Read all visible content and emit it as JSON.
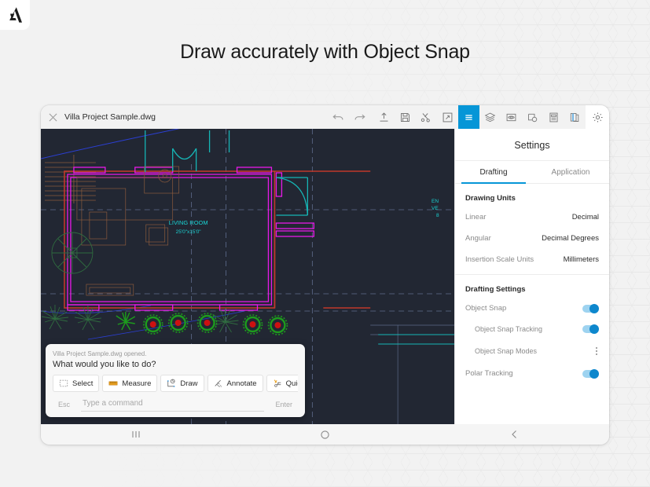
{
  "brand": {
    "logo_icon": "autodesk-logo"
  },
  "headline": "Draw accurately with Object Snap",
  "window": {
    "document_title": "Villa Project Sample.dwg",
    "close_icon": "close-icon",
    "toolbar": [
      {
        "name": "undo",
        "icon": "undo-icon",
        "state": "normal"
      },
      {
        "name": "redo",
        "icon": "redo-icon",
        "state": "normal"
      },
      {
        "name": "export",
        "icon": "export-upload-icon",
        "state": "normal"
      },
      {
        "name": "save",
        "icon": "save-floppy-icon",
        "state": "normal"
      },
      {
        "name": "trim",
        "icon": "trim-scissors-icon",
        "state": "normal"
      },
      {
        "name": "zoom-extents",
        "icon": "zoom-extents-icon",
        "state": "normal"
      },
      {
        "name": "menu",
        "icon": "hamburger-menu-icon",
        "state": "active-blue"
      },
      {
        "name": "layers",
        "icon": "layers-icon",
        "state": "normal"
      },
      {
        "name": "visibility",
        "icon": "eye-visibility-icon",
        "state": "normal"
      },
      {
        "name": "snap",
        "icon": "object-snap-icon",
        "state": "normal"
      },
      {
        "name": "properties",
        "icon": "properties-panel-icon",
        "state": "normal"
      },
      {
        "name": "copy",
        "icon": "copy-document-icon",
        "state": "normal"
      },
      {
        "name": "settings",
        "icon": "gear-settings-icon",
        "state": "active-white"
      }
    ]
  },
  "canvas": {
    "room_label": "LIVING ROOM",
    "room_dimensions": "25'0\"x15'0\"",
    "side_label_line1": "EN",
    "side_label_line2": "VE",
    "side_label_line3": "8",
    "colors": {
      "background": "#222733",
      "wall": "#c0392b",
      "window": "#e819e8",
      "door": "#16b5b5",
      "text": "#19d4d4",
      "guide": "#6b7a9e",
      "furniture": "#8a5a3c",
      "vegetation": "#1d9b1d",
      "vegetation_center": "#cc1111",
      "contour": "#2b3fd4"
    }
  },
  "command_palette": {
    "status": "Villa Project Sample.dwg opened.",
    "prompt": "What would you like to do?",
    "actions": [
      {
        "label": "Select",
        "icon": "select-marquee-icon"
      },
      {
        "label": "Measure",
        "icon": "measure-ruler-icon"
      },
      {
        "label": "Draw",
        "icon": "draw-icon"
      },
      {
        "label": "Annotate",
        "icon": "annotate-icon"
      },
      {
        "label": "Quick Tr",
        "icon": "quick-trim-icon"
      }
    ],
    "esc_label": "Esc",
    "enter_label": "Enter",
    "input_value": "",
    "input_placeholder": "Type a command"
  },
  "settings": {
    "title": "Settings",
    "tabs": [
      {
        "label": "Drafting",
        "active": true
      },
      {
        "label": "Application",
        "active": false
      }
    ],
    "groups": [
      {
        "header": "Drawing Units",
        "rows": [
          {
            "label": "Linear",
            "value": "Decimal",
            "control": "value"
          },
          {
            "label": "Angular",
            "value": "Decimal Degrees",
            "control": "value"
          },
          {
            "label": "Insertion Scale Units",
            "value": "Millimeters",
            "control": "value"
          }
        ]
      },
      {
        "header": "Drafting Settings",
        "rows": [
          {
            "label": "Object Snap",
            "control": "toggle",
            "on": true,
            "indent": false
          },
          {
            "label": "Object Snap Tracking",
            "control": "toggle",
            "on": true,
            "indent": true
          },
          {
            "label": "Object Snap Modes",
            "control": "kebab",
            "indent": true
          },
          {
            "label": "Polar Tracking",
            "control": "toggle",
            "on": true,
            "indent": false
          }
        ]
      }
    ],
    "accent_color": "#0696d7"
  },
  "android_nav": [
    {
      "name": "recents",
      "icon": "recents-icon"
    },
    {
      "name": "home",
      "icon": "home-circle-icon"
    },
    {
      "name": "back",
      "icon": "back-chevron-icon"
    }
  ]
}
